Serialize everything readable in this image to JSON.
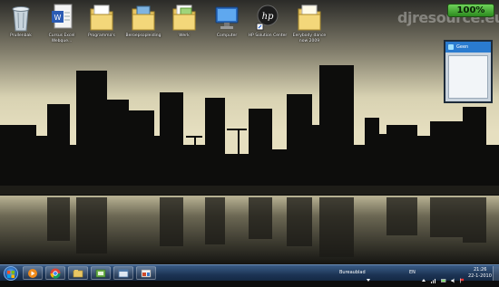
{
  "desktop": {
    "icons": [
      {
        "label": "Prullenbak",
        "icon": "recycle-bin-icon"
      },
      {
        "label": "Cursus Excel Webque...",
        "icon": "document-icon"
      },
      {
        "label": "Programma's",
        "icon": "folder-icon"
      },
      {
        "label": "Beroepsopleiding",
        "icon": "folder-icon"
      },
      {
        "label": "Werk",
        "icon": "folder-icon"
      },
      {
        "label": "Computer",
        "icon": "computer-icon"
      },
      {
        "label": "HP Solution Center",
        "icon": "hp-icon"
      },
      {
        "label": "Eerybody dance now 2009",
        "icon": "folder-icon"
      }
    ]
  },
  "watermark": "djresource.eu",
  "gadgets": {
    "battery": {
      "value": "100%",
      "level": 1.0,
      "color": "#3cb72c"
    },
    "chat": {
      "status": "Geen"
    }
  },
  "taskbar": {
    "pinned": [
      {
        "icon": "media-player-icon"
      },
      {
        "icon": "chrome-icon"
      },
      {
        "icon": "explorer-icon"
      },
      {
        "icon": "app-icon"
      },
      {
        "icon": "window-icon"
      },
      {
        "icon": "folder-window-icon"
      }
    ],
    "tray_label": "Bureaublad",
    "language": "EN",
    "time": "21:26",
    "date": "22-1-2010"
  },
  "colors": {
    "sky_top": "#2a2a28",
    "sky_glow": "#d9d3b4",
    "water": "#1a1a17"
  }
}
